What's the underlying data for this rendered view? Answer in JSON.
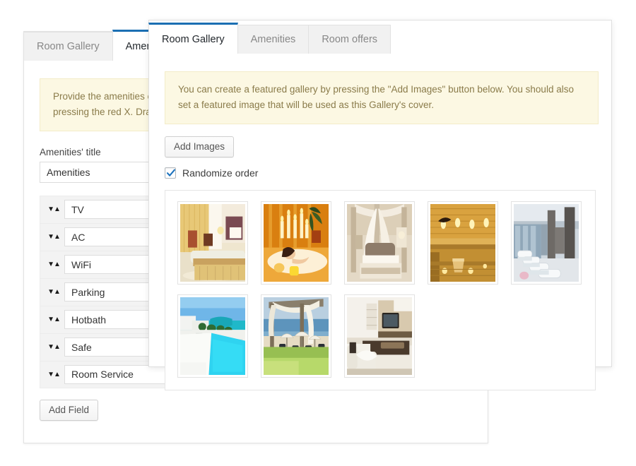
{
  "background_panel": {
    "tabs": [
      {
        "label": "Room Gallery",
        "active": false
      },
      {
        "label": "Amenities",
        "active": true
      }
    ],
    "notice": "Provide the amenities of this room. You can add as many amenities. You can delete any field by pressing the red X. Drag the fields to re-arrange them.",
    "title_label": "Amenities' title",
    "title_value": "Amenities",
    "amenities": [
      {
        "value": "TV"
      },
      {
        "value": "AC"
      },
      {
        "value": "WiFi"
      },
      {
        "value": "Parking"
      },
      {
        "value": "Hotbath"
      },
      {
        "value": "Safe"
      },
      {
        "value": "Room Service"
      }
    ],
    "delete_icon": "✖",
    "sorter_icon": "▼▲",
    "add_field_label": "Add Field"
  },
  "modal": {
    "tabs": [
      {
        "label": "Room Gallery",
        "active": true
      },
      {
        "label": "Amenities",
        "active": false
      },
      {
        "label": "Room offers",
        "active": false
      }
    ],
    "notice": "You can create a featured gallery by pressing the \"Add Images\" button below. You should also set a featured image that will be used as this Gallery's cover.",
    "add_images_label": "Add Images",
    "randomize_label": "Randomize order",
    "randomize_checked": true,
    "gallery_images": [
      {
        "alt": "hotel-room-yellow-curtains",
        "theme": "room-yellow"
      },
      {
        "alt": "woman-in-bath-candles",
        "theme": "bath-candles"
      },
      {
        "alt": "four-poster-canopy-bed",
        "theme": "canopy-bed"
      },
      {
        "alt": "wooden-sauna-interior",
        "theme": "sauna"
      },
      {
        "alt": "spa-lounge-beds-columns",
        "theme": "spa-lounge"
      },
      {
        "alt": "beach-resort-pool-terrace",
        "theme": "pool-terrace"
      },
      {
        "alt": "beach-cabana-umbrellas",
        "theme": "beach-cabana"
      },
      {
        "alt": "modern-living-room-sofa-tv",
        "theme": "living-room"
      }
    ]
  },
  "colors": {
    "accent_blue": "#1b6fb3",
    "notice_bg": "#fcf8e3",
    "notice_text": "#8a7b4a",
    "delete_red": "#c3291a",
    "checkbox_blue": "#1e73be",
    "panel_border": "#e2e2e2"
  }
}
